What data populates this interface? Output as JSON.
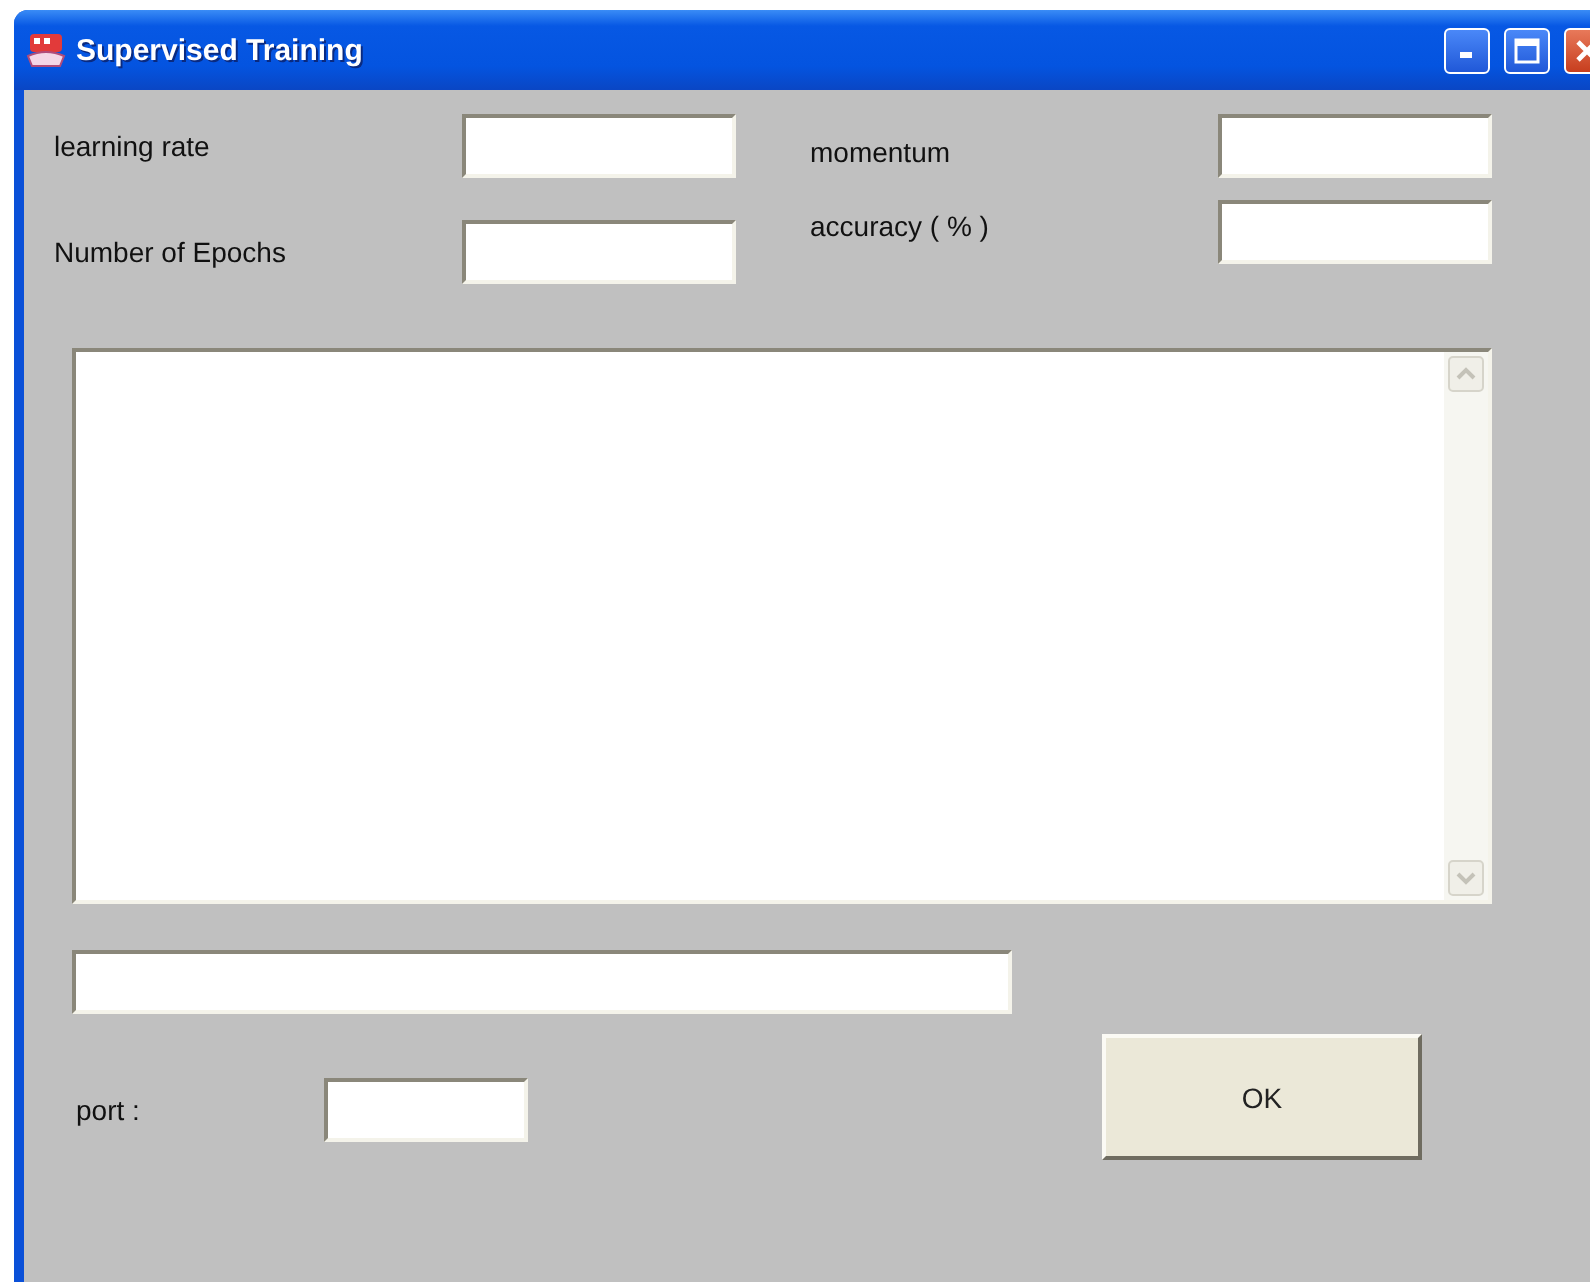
{
  "window": {
    "title": "Supervised Training"
  },
  "left_fields": [
    {
      "label": "learning rate"
    },
    {
      "label": "Number of Epochs"
    }
  ],
  "right_fields": [
    {
      "label": "momentum"
    },
    {
      "label": "accuracy ( % )"
    }
  ],
  "port": {
    "label": "port :"
  },
  "buttons": [
    "OK"
  ]
}
